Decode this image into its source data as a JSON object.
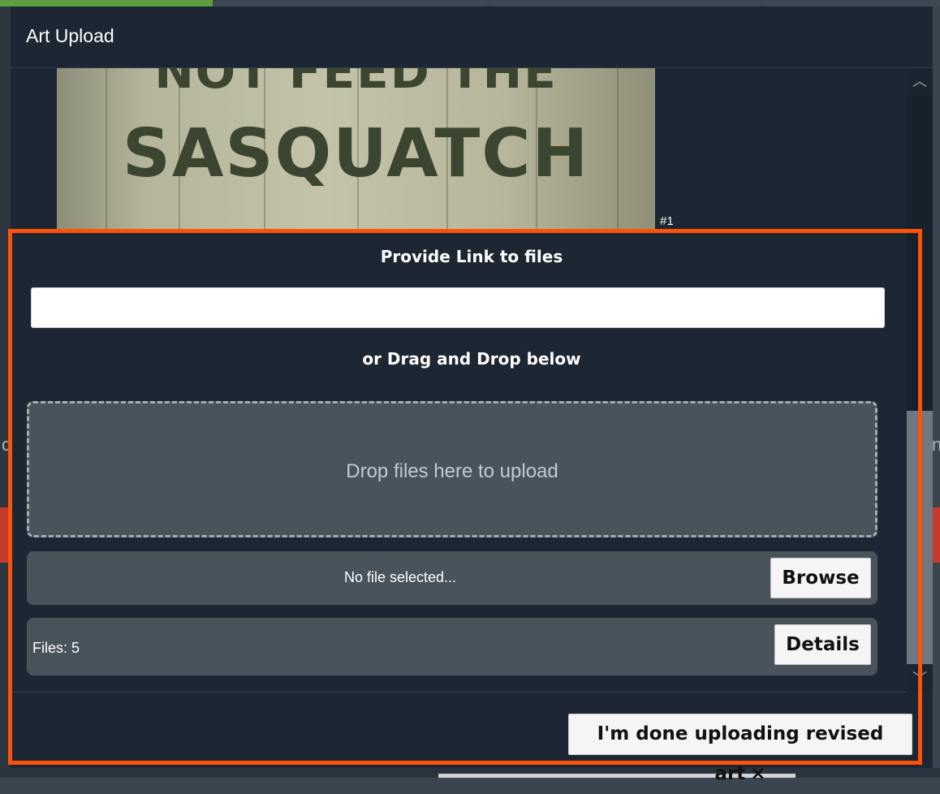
{
  "modal": {
    "title": "Art Upload"
  },
  "art": {
    "top_text": "NOT FEED THE",
    "main_text": "SASQUATCH",
    "number": "#1"
  },
  "upload": {
    "link_label": "Provide Link to files",
    "link_value": "",
    "drag_label": "or Drag and Drop below",
    "drop_text": "Drop files here to upload",
    "no_file_text": "No file selected...",
    "browse_label": "Browse",
    "files_count": "Files: 5",
    "details_label": "Details"
  },
  "footer": {
    "done_label": "I'm done uploading revised art",
    "close_glyph": "×"
  },
  "scrollbar": {
    "up_glyph": "︿",
    "down_glyph": "﹀"
  },
  "colors": {
    "modal_bg": "#1c2733",
    "highlight": "#ff5108",
    "panel": "#48535c"
  }
}
